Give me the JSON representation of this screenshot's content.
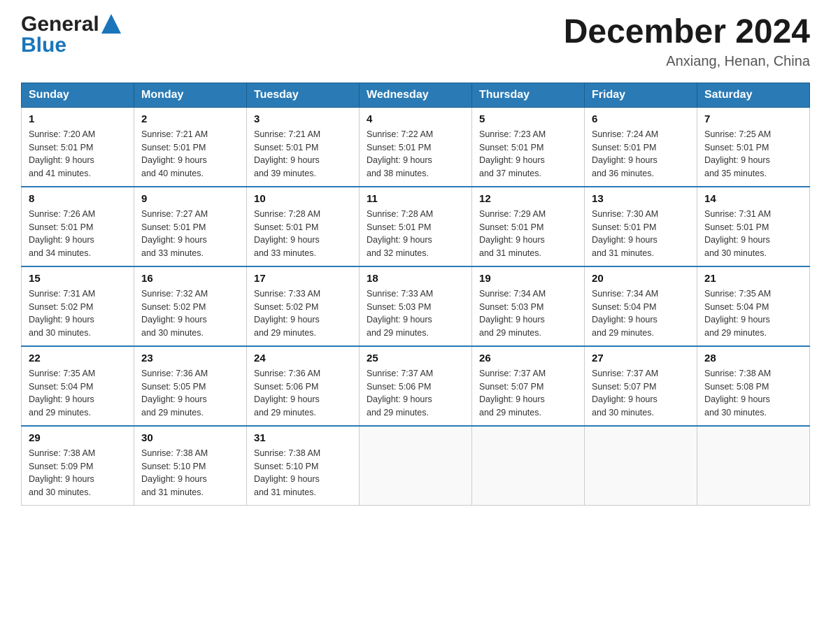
{
  "header": {
    "logo_general": "General",
    "logo_blue": "Blue",
    "title": "December 2024",
    "location": "Anxiang, Henan, China"
  },
  "calendar": {
    "days_of_week": [
      "Sunday",
      "Monday",
      "Tuesday",
      "Wednesday",
      "Thursday",
      "Friday",
      "Saturday"
    ],
    "weeks": [
      [
        {
          "day": "1",
          "sunrise": "7:20 AM",
          "sunset": "5:01 PM",
          "daylight": "9 hours and 41 minutes."
        },
        {
          "day": "2",
          "sunrise": "7:21 AM",
          "sunset": "5:01 PM",
          "daylight": "9 hours and 40 minutes."
        },
        {
          "day": "3",
          "sunrise": "7:21 AM",
          "sunset": "5:01 PM",
          "daylight": "9 hours and 39 minutes."
        },
        {
          "day": "4",
          "sunrise": "7:22 AM",
          "sunset": "5:01 PM",
          "daylight": "9 hours and 38 minutes."
        },
        {
          "day": "5",
          "sunrise": "7:23 AM",
          "sunset": "5:01 PM",
          "daylight": "9 hours and 37 minutes."
        },
        {
          "day": "6",
          "sunrise": "7:24 AM",
          "sunset": "5:01 PM",
          "daylight": "9 hours and 36 minutes."
        },
        {
          "day": "7",
          "sunrise": "7:25 AM",
          "sunset": "5:01 PM",
          "daylight": "9 hours and 35 minutes."
        }
      ],
      [
        {
          "day": "8",
          "sunrise": "7:26 AM",
          "sunset": "5:01 PM",
          "daylight": "9 hours and 34 minutes."
        },
        {
          "day": "9",
          "sunrise": "7:27 AM",
          "sunset": "5:01 PM",
          "daylight": "9 hours and 33 minutes."
        },
        {
          "day": "10",
          "sunrise": "7:28 AM",
          "sunset": "5:01 PM",
          "daylight": "9 hours and 33 minutes."
        },
        {
          "day": "11",
          "sunrise": "7:28 AM",
          "sunset": "5:01 PM",
          "daylight": "9 hours and 32 minutes."
        },
        {
          "day": "12",
          "sunrise": "7:29 AM",
          "sunset": "5:01 PM",
          "daylight": "9 hours and 31 minutes."
        },
        {
          "day": "13",
          "sunrise": "7:30 AM",
          "sunset": "5:01 PM",
          "daylight": "9 hours and 31 minutes."
        },
        {
          "day": "14",
          "sunrise": "7:31 AM",
          "sunset": "5:01 PM",
          "daylight": "9 hours and 30 minutes."
        }
      ],
      [
        {
          "day": "15",
          "sunrise": "7:31 AM",
          "sunset": "5:02 PM",
          "daylight": "9 hours and 30 minutes."
        },
        {
          "day": "16",
          "sunrise": "7:32 AM",
          "sunset": "5:02 PM",
          "daylight": "9 hours and 30 minutes."
        },
        {
          "day": "17",
          "sunrise": "7:33 AM",
          "sunset": "5:02 PM",
          "daylight": "9 hours and 29 minutes."
        },
        {
          "day": "18",
          "sunrise": "7:33 AM",
          "sunset": "5:03 PM",
          "daylight": "9 hours and 29 minutes."
        },
        {
          "day": "19",
          "sunrise": "7:34 AM",
          "sunset": "5:03 PM",
          "daylight": "9 hours and 29 minutes."
        },
        {
          "day": "20",
          "sunrise": "7:34 AM",
          "sunset": "5:04 PM",
          "daylight": "9 hours and 29 minutes."
        },
        {
          "day": "21",
          "sunrise": "7:35 AM",
          "sunset": "5:04 PM",
          "daylight": "9 hours and 29 minutes."
        }
      ],
      [
        {
          "day": "22",
          "sunrise": "7:35 AM",
          "sunset": "5:04 PM",
          "daylight": "9 hours and 29 minutes."
        },
        {
          "day": "23",
          "sunrise": "7:36 AM",
          "sunset": "5:05 PM",
          "daylight": "9 hours and 29 minutes."
        },
        {
          "day": "24",
          "sunrise": "7:36 AM",
          "sunset": "5:06 PM",
          "daylight": "9 hours and 29 minutes."
        },
        {
          "day": "25",
          "sunrise": "7:37 AM",
          "sunset": "5:06 PM",
          "daylight": "9 hours and 29 minutes."
        },
        {
          "day": "26",
          "sunrise": "7:37 AM",
          "sunset": "5:07 PM",
          "daylight": "9 hours and 29 minutes."
        },
        {
          "day": "27",
          "sunrise": "7:37 AM",
          "sunset": "5:07 PM",
          "daylight": "9 hours and 30 minutes."
        },
        {
          "day": "28",
          "sunrise": "7:38 AM",
          "sunset": "5:08 PM",
          "daylight": "9 hours and 30 minutes."
        }
      ],
      [
        {
          "day": "29",
          "sunrise": "7:38 AM",
          "sunset": "5:09 PM",
          "daylight": "9 hours and 30 minutes."
        },
        {
          "day": "30",
          "sunrise": "7:38 AM",
          "sunset": "5:10 PM",
          "daylight": "9 hours and 31 minutes."
        },
        {
          "day": "31",
          "sunrise": "7:38 AM",
          "sunset": "5:10 PM",
          "daylight": "9 hours and 31 minutes."
        },
        null,
        null,
        null,
        null
      ]
    ],
    "labels": {
      "sunrise": "Sunrise:",
      "sunset": "Sunset:",
      "daylight": "Daylight:"
    }
  }
}
